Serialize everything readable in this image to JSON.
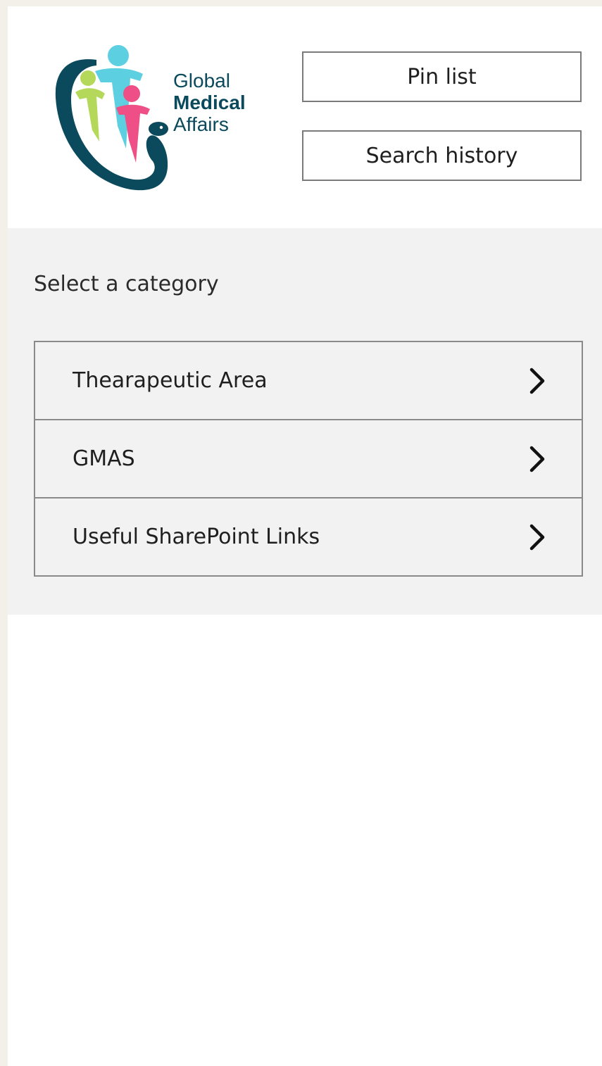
{
  "brand": {
    "logo_line1": "Global",
    "logo_line2": "Medical",
    "logo_line3": "Affairs",
    "colors": {
      "dark_teal": "#0a4a5c",
      "cyan": "#5ccfe0",
      "lime": "#b4d95a",
      "pink": "#ee4f86"
    }
  },
  "header": {
    "pin_list_label": "Pin list",
    "search_history_label": "Search history"
  },
  "categories": {
    "heading": "Select a category",
    "items": [
      {
        "label": "Thearapeutic Area",
        "icon": "chevron-right-icon"
      },
      {
        "label": "GMAS",
        "icon": "chevron-right-icon"
      },
      {
        "label": "Useful SharePoint Links",
        "icon": "chevron-right-icon"
      }
    ]
  }
}
